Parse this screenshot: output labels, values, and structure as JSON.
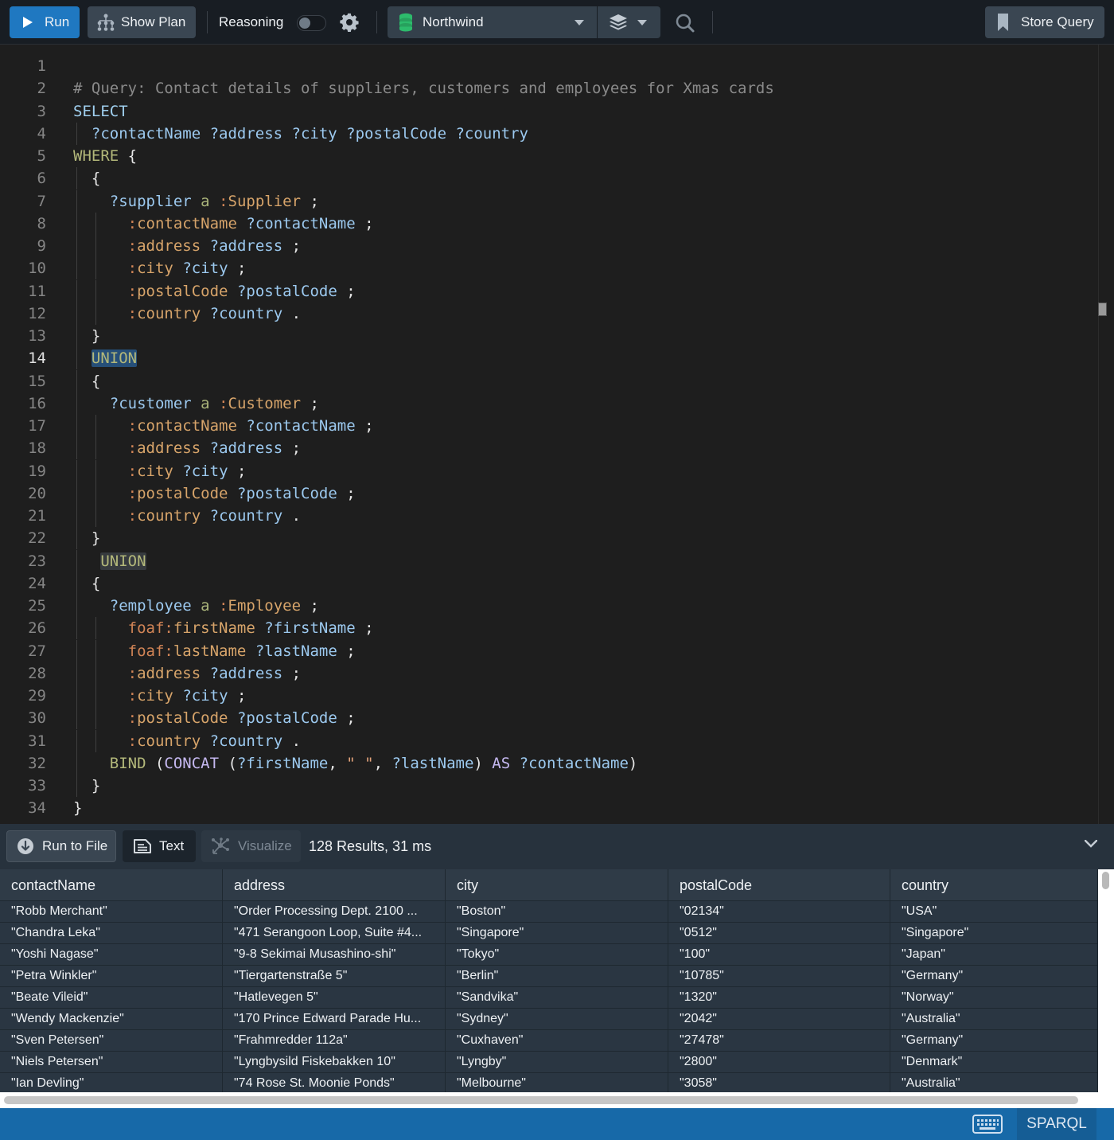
{
  "toolbar": {
    "run_label": "Run",
    "show_plan_label": "Show Plan",
    "reasoning_label": "Reasoning",
    "reasoning_enabled": false,
    "database": "Northwind",
    "store_query_label": "Store Query"
  },
  "editor": {
    "active_line": 14,
    "lines": [
      {
        "n": "1",
        "tokens": []
      },
      {
        "n": "2",
        "tokens": [
          {
            "t": "# Query: Contact details of suppliers, customers and employees for Xmas cards",
            "c": "c-comment"
          }
        ]
      },
      {
        "n": "3",
        "tokens": [
          {
            "t": "SELECT",
            "c": "c-kw"
          }
        ]
      },
      {
        "n": "4",
        "tokens": [
          {
            "t": "  "
          },
          {
            "t": "?contactName ?address ?city ?postalCode ?country",
            "c": "c-var"
          }
        ]
      },
      {
        "n": "5",
        "tokens": [
          {
            "t": "WHERE",
            "c": "c-kw2"
          },
          {
            "t": " {",
            "c": "c-punc"
          }
        ]
      },
      {
        "n": "6",
        "tokens": [
          {
            "t": "  {",
            "c": "c-punc"
          }
        ]
      },
      {
        "n": "7",
        "tokens": [
          {
            "t": "    "
          },
          {
            "t": "?supplier",
            "c": "c-var"
          },
          {
            "t": " "
          },
          {
            "t": "a",
            "c": "c-a"
          },
          {
            "t": " "
          },
          {
            "t": ":",
            "c": "c-colon"
          },
          {
            "t": "Supplier",
            "c": "c-pred"
          },
          {
            "t": " ;",
            "c": "c-punc"
          }
        ]
      },
      {
        "n": "8",
        "tokens": [
          {
            "t": "      "
          },
          {
            "t": ":",
            "c": "c-colon"
          },
          {
            "t": "contactName",
            "c": "c-pred"
          },
          {
            "t": " "
          },
          {
            "t": "?contactName",
            "c": "c-var"
          },
          {
            "t": " ;",
            "c": "c-punc"
          }
        ]
      },
      {
        "n": "9",
        "tokens": [
          {
            "t": "      "
          },
          {
            "t": ":",
            "c": "c-colon"
          },
          {
            "t": "address",
            "c": "c-pred"
          },
          {
            "t": " "
          },
          {
            "t": "?address",
            "c": "c-var"
          },
          {
            "t": " ;",
            "c": "c-punc"
          }
        ]
      },
      {
        "n": "10",
        "tokens": [
          {
            "t": "      "
          },
          {
            "t": ":",
            "c": "c-colon"
          },
          {
            "t": "city",
            "c": "c-pred"
          },
          {
            "t": " "
          },
          {
            "t": "?city",
            "c": "c-var"
          },
          {
            "t": " ;",
            "c": "c-punc"
          }
        ]
      },
      {
        "n": "11",
        "tokens": [
          {
            "t": "      "
          },
          {
            "t": ":",
            "c": "c-colon"
          },
          {
            "t": "postalCode",
            "c": "c-pred"
          },
          {
            "t": " "
          },
          {
            "t": "?postalCode",
            "c": "c-var"
          },
          {
            "t": " ;",
            "c": "c-punc"
          }
        ]
      },
      {
        "n": "12",
        "tokens": [
          {
            "t": "      "
          },
          {
            "t": ":",
            "c": "c-colon"
          },
          {
            "t": "country",
            "c": "c-pred"
          },
          {
            "t": " "
          },
          {
            "t": "?country",
            "c": "c-var"
          },
          {
            "t": " .",
            "c": "c-punc"
          }
        ]
      },
      {
        "n": "13",
        "tokens": [
          {
            "t": "  }",
            "c": "c-punc"
          }
        ]
      },
      {
        "n": "14",
        "tokens": [
          {
            "t": "  "
          },
          {
            "t": "UNION",
            "c": "c-kw2 union-hl"
          }
        ]
      },
      {
        "n": "15",
        "tokens": [
          {
            "t": "  {",
            "c": "c-punc"
          }
        ]
      },
      {
        "n": "16",
        "tokens": [
          {
            "t": "    "
          },
          {
            "t": "?customer",
            "c": "c-var"
          },
          {
            "t": " "
          },
          {
            "t": "a",
            "c": "c-a"
          },
          {
            "t": " "
          },
          {
            "t": ":",
            "c": "c-colon"
          },
          {
            "t": "Customer",
            "c": "c-pred"
          },
          {
            "t": " ;",
            "c": "c-punc"
          }
        ]
      },
      {
        "n": "17",
        "tokens": [
          {
            "t": "      "
          },
          {
            "t": ":",
            "c": "c-colon"
          },
          {
            "t": "contactName",
            "c": "c-pred"
          },
          {
            "t": " "
          },
          {
            "t": "?contactName",
            "c": "c-var"
          },
          {
            "t": " ;",
            "c": "c-punc"
          }
        ]
      },
      {
        "n": "18",
        "tokens": [
          {
            "t": "      "
          },
          {
            "t": ":",
            "c": "c-colon"
          },
          {
            "t": "address",
            "c": "c-pred"
          },
          {
            "t": " "
          },
          {
            "t": "?address",
            "c": "c-var"
          },
          {
            "t": " ;",
            "c": "c-punc"
          }
        ]
      },
      {
        "n": "19",
        "tokens": [
          {
            "t": "      "
          },
          {
            "t": ":",
            "c": "c-colon"
          },
          {
            "t": "city",
            "c": "c-pred"
          },
          {
            "t": " "
          },
          {
            "t": "?city",
            "c": "c-var"
          },
          {
            "t": " ;",
            "c": "c-punc"
          }
        ]
      },
      {
        "n": "20",
        "tokens": [
          {
            "t": "      "
          },
          {
            "t": ":",
            "c": "c-colon"
          },
          {
            "t": "postalCode",
            "c": "c-pred"
          },
          {
            "t": " "
          },
          {
            "t": "?postalCode",
            "c": "c-var"
          },
          {
            "t": " ;",
            "c": "c-punc"
          }
        ]
      },
      {
        "n": "21",
        "tokens": [
          {
            "t": "      "
          },
          {
            "t": ":",
            "c": "c-colon"
          },
          {
            "t": "country",
            "c": "c-pred"
          },
          {
            "t": " "
          },
          {
            "t": "?country",
            "c": "c-var"
          },
          {
            "t": " .",
            "c": "c-punc"
          }
        ]
      },
      {
        "n": "22",
        "tokens": [
          {
            "t": "  }",
            "c": "c-punc"
          }
        ]
      },
      {
        "n": "23",
        "tokens": [
          {
            "t": "   "
          },
          {
            "t": "UNION",
            "c": "c-kw2 union-hl2"
          }
        ]
      },
      {
        "n": "24",
        "tokens": [
          {
            "t": "  {",
            "c": "c-punc"
          }
        ]
      },
      {
        "n": "25",
        "tokens": [
          {
            "t": "    "
          },
          {
            "t": "?employee",
            "c": "c-var"
          },
          {
            "t": " "
          },
          {
            "t": "a",
            "c": "c-a"
          },
          {
            "t": " "
          },
          {
            "t": ":",
            "c": "c-colon"
          },
          {
            "t": "Employee",
            "c": "c-pred"
          },
          {
            "t": " ;",
            "c": "c-punc"
          }
        ]
      },
      {
        "n": "26",
        "tokens": [
          {
            "t": "      "
          },
          {
            "t": "foaf:",
            "c": "c-colon"
          },
          {
            "t": "firstName",
            "c": "c-pred"
          },
          {
            "t": " "
          },
          {
            "t": "?firstName",
            "c": "c-var"
          },
          {
            "t": " ;",
            "c": "c-punc"
          }
        ]
      },
      {
        "n": "27",
        "tokens": [
          {
            "t": "      "
          },
          {
            "t": "foaf:",
            "c": "c-colon"
          },
          {
            "t": "lastName",
            "c": "c-pred"
          },
          {
            "t": " "
          },
          {
            "t": "?lastName",
            "c": "c-var"
          },
          {
            "t": " ;",
            "c": "c-punc"
          }
        ]
      },
      {
        "n": "28",
        "tokens": [
          {
            "t": "      "
          },
          {
            "t": ":",
            "c": "c-colon"
          },
          {
            "t": "address",
            "c": "c-pred"
          },
          {
            "t": " "
          },
          {
            "t": "?address",
            "c": "c-var"
          },
          {
            "t": " ;",
            "c": "c-punc"
          }
        ]
      },
      {
        "n": "29",
        "tokens": [
          {
            "t": "      "
          },
          {
            "t": ":",
            "c": "c-colon"
          },
          {
            "t": "city",
            "c": "c-pred"
          },
          {
            "t": " "
          },
          {
            "t": "?city",
            "c": "c-var"
          },
          {
            "t": " ;",
            "c": "c-punc"
          }
        ]
      },
      {
        "n": "30",
        "tokens": [
          {
            "t": "      "
          },
          {
            "t": ":",
            "c": "c-colon"
          },
          {
            "t": "postalCode",
            "c": "c-pred"
          },
          {
            "t": " "
          },
          {
            "t": "?postalCode",
            "c": "c-var"
          },
          {
            "t": " ;",
            "c": "c-punc"
          }
        ]
      },
      {
        "n": "31",
        "tokens": [
          {
            "t": "      "
          },
          {
            "t": ":",
            "c": "c-colon"
          },
          {
            "t": "country",
            "c": "c-pred"
          },
          {
            "t": " "
          },
          {
            "t": "?country",
            "c": "c-var"
          },
          {
            "t": " .",
            "c": "c-punc"
          }
        ]
      },
      {
        "n": "32",
        "tokens": [
          {
            "t": "    "
          },
          {
            "t": "BIND",
            "c": "c-kw2"
          },
          {
            "t": " (",
            "c": "c-punc"
          },
          {
            "t": "CONCAT",
            "c": "c-fn"
          },
          {
            "t": " (",
            "c": "c-punc"
          },
          {
            "t": "?firstName",
            "c": "c-var"
          },
          {
            "t": ", ",
            "c": "c-punc"
          },
          {
            "t": "\" \"",
            "c": "c-str"
          },
          {
            "t": ", ",
            "c": "c-punc"
          },
          {
            "t": "?lastName",
            "c": "c-var"
          },
          {
            "t": ") ",
            "c": "c-punc"
          },
          {
            "t": "AS",
            "c": "c-fn"
          },
          {
            "t": " "
          },
          {
            "t": "?contactName",
            "c": "c-var"
          },
          {
            "t": ")",
            "c": "c-punc"
          }
        ]
      },
      {
        "n": "33",
        "tokens": [
          {
            "t": "  }",
            "c": "c-punc"
          }
        ]
      },
      {
        "n": "34",
        "tokens": [
          {
            "t": "}",
            "c": "c-punc"
          }
        ]
      }
    ]
  },
  "results_bar": {
    "run_to_file_label": "Run to File",
    "text_label": "Text",
    "visualize_label": "Visualize",
    "results_summary": "128 Results,  31 ms"
  },
  "table": {
    "columns": [
      "contactName",
      "address",
      "city",
      "postalCode",
      "country"
    ],
    "rows": [
      [
        "\"Robb Merchant\"",
        "\"Order Processing Dept. 2100 ...",
        "\"Boston\"",
        "\"02134\"",
        "\"USA\""
      ],
      [
        "\"Chandra Leka\"",
        "\"471 Serangoon Loop, Suite #4...",
        "\"Singapore\"",
        "\"0512\"",
        "\"Singapore\""
      ],
      [
        "\"Yoshi Nagase\"",
        "\"9-8 Sekimai Musashino-shi\"",
        "\"Tokyo\"",
        "\"100\"",
        "\"Japan\""
      ],
      [
        "\"Petra Winkler\"",
        "\"Tiergartenstraße 5\"",
        "\"Berlin\"",
        "\"10785\"",
        "\"Germany\""
      ],
      [
        "\"Beate Vileid\"",
        "\"Hatlevegen 5\"",
        "\"Sandvika\"",
        "\"1320\"",
        "\"Norway\""
      ],
      [
        "\"Wendy Mackenzie\"",
        "\"170 Prince Edward Parade Hu...",
        "\"Sydney\"",
        "\"2042\"",
        "\"Australia\""
      ],
      [
        "\"Sven Petersen\"",
        "\"Frahmredder 112a\"",
        "\"Cuxhaven\"",
        "\"27478\"",
        "\"Germany\""
      ],
      [
        "\"Niels Petersen\"",
        "\"Lyngbysild Fiskebakken 10\"",
        "\"Lyngby\"",
        "\"2800\"",
        "\"Denmark\""
      ],
      [
        "\"Ian Devling\"",
        "\"74 Rose St. Moonie Ponds\"",
        "\"Melbourne\"",
        "\"3058\"",
        "\"Australia\""
      ]
    ]
  },
  "status_bar": {
    "language": "SPARQL"
  }
}
